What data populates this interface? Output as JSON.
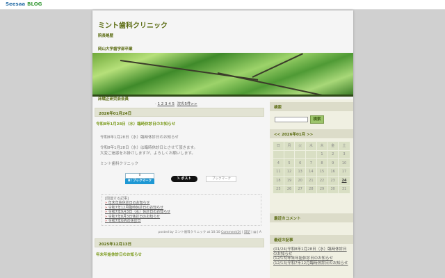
{
  "topbar": {
    "logo": "Seesaa",
    "logo2": "BLOG"
  },
  "header": {
    "title": "ミント歯科クリニック",
    "lines": [
      "院長略歴",
      "岡山大学歯学部卒業",
      "床矯正研究会会員"
    ]
  },
  "pager": {
    "pages": "1 2 3 4 5",
    "next": "次の5件>>"
  },
  "entries": [
    {
      "date": "2026年01月24日",
      "title": "令和8年1月28日（水）臨時休診日のお知らせ",
      "body": [
        "令和8年1月28日（水）臨時休診日のお知らせ",
        "令和8年1月28日（水）は臨時休診日とさせて頂きます。",
        "大変ご迷惑をお掛けしますが、よろしくお願いします。",
        "ミント歯科クリニック"
      ],
      "social": {
        "hatena_count": "0",
        "hatena": "B! ブックマーク",
        "post": "𝕏 ポスト",
        "bookmark": "ブックマーク"
      },
      "related_title": "[関連する記事]",
      "related": [
        "年末年始休診日のお知らせ",
        "令和7年12月臨時休診日のお知らせ",
        "令和7年9月3日（水）休診日のお知らせ",
        "令和7年8月3日休診日のお知らせ",
        "令和7年GWの休診日"
      ],
      "posted": "posted by ミント歯科クリニック at 10:10",
      "comment": "Comment(0)",
      "diary": "日記"
    },
    {
      "date": "2025年12月13日",
      "title": "年末年始休診日のお知らせ"
    }
  ],
  "sidebar": {
    "search_title": "検索",
    "search_button": "検索",
    "search_value": "",
    "calendar_title": "<< 2026年01月 >>",
    "weekdays": [
      "日",
      "月",
      "火",
      "水",
      "木",
      "金",
      "土"
    ],
    "weeks": [
      [
        "",
        "",
        "",
        "",
        "1",
        "2",
        "3"
      ],
      [
        "4",
        "5",
        "6",
        "7",
        "8",
        "9",
        "10"
      ],
      [
        "11",
        "12",
        "13",
        "14",
        "15",
        "16",
        "17"
      ],
      [
        "18",
        "19",
        "20",
        "21",
        "22",
        "23",
        "24"
      ],
      [
        "25",
        "26",
        "27",
        "28",
        "29",
        "30",
        "31"
      ]
    ],
    "comments_title": "最近のコメント",
    "recent_title": "最近の記事",
    "recent": [
      "(01/24)令和8年1月28日（水）臨時休診日のお知らせ",
      "(12/13)年末年始休診日のお知らせ",
      "(12/13)令和7年12月臨時休診日のお知らせ"
    ]
  }
}
